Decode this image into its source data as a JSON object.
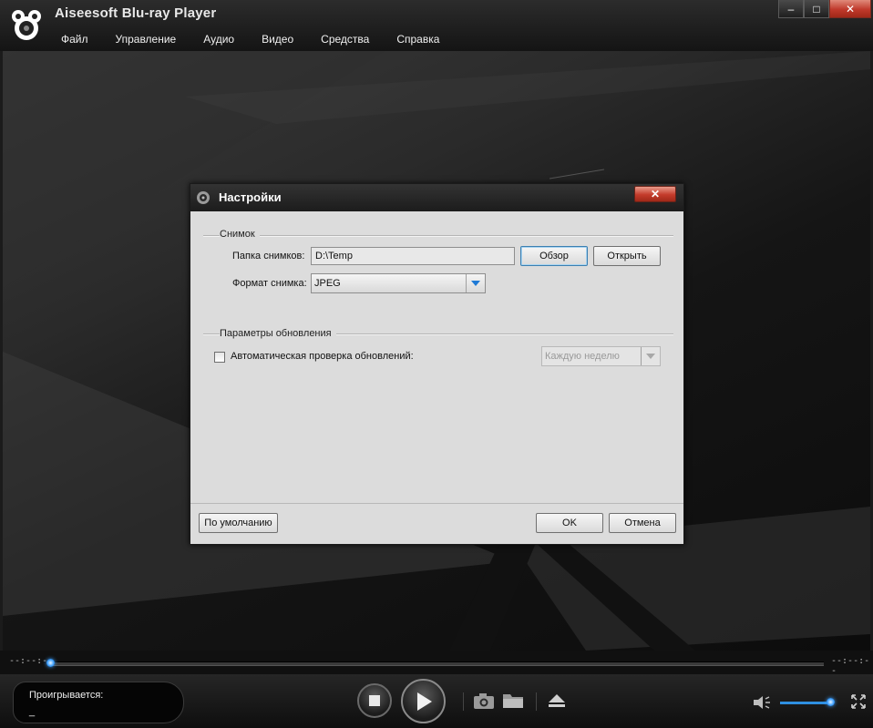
{
  "app": {
    "title": "Aiseesoft Blu-ray Player",
    "window_controls": {
      "minimize": "–",
      "maximize": "□",
      "close": "✕"
    }
  },
  "menu": [
    {
      "id": "file",
      "label": "Файл"
    },
    {
      "id": "control",
      "label": "Управление"
    },
    {
      "id": "audio",
      "label": "Аудио"
    },
    {
      "id": "video",
      "label": "Видео"
    },
    {
      "id": "tools",
      "label": "Средства"
    },
    {
      "id": "help",
      "label": "Справка"
    }
  ],
  "dialog": {
    "title": "Настройки",
    "close_label": "✕",
    "snapshot": {
      "legend": "Снимок",
      "folder_label": "Папка снимков:",
      "folder_value": "D:\\Temp",
      "browse_label": "Обзор",
      "open_label": "Открыть",
      "format_label": "Формат снимка:",
      "format_value": "JPEG"
    },
    "updates": {
      "legend": "Параметры обновления",
      "auto_check_label": "Автоматическая проверка обновлений:",
      "auto_check_checked": false,
      "frequency_value": "Каждую неделю"
    },
    "footer": {
      "defaults_label": "По умолчанию",
      "ok_label": "OK",
      "cancel_label": "Отмена"
    }
  },
  "player": {
    "time_elapsed": "--:--:--",
    "time_total": "--:--:--",
    "progress": 0,
    "status_label": "Проигрывается:",
    "status_value": "_",
    "volume": 0.95,
    "accent": "#2f8fe0"
  },
  "icons": {
    "logo": "aiseesoft-logo-icon",
    "stop": "stop-icon",
    "play": "play-icon",
    "snapshot": "camera-icon",
    "open": "folder-icon",
    "eject": "eject-icon",
    "volume": "speaker-icon",
    "fullscreen": "fullscreen-icon"
  }
}
